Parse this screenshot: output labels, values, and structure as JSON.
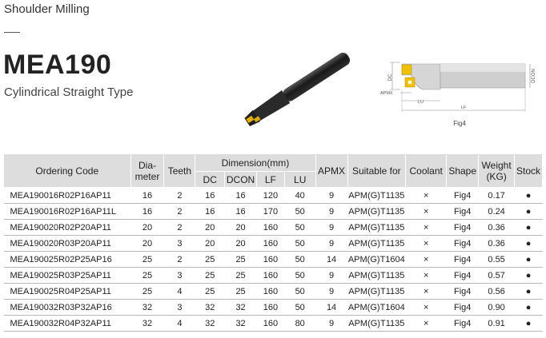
{
  "header": {
    "category": "Shoulder Milling",
    "model": "MEA190",
    "subtitle": "Cylindrical Straight Type"
  },
  "drawing": {
    "labels": {
      "dc": "DC",
      "dcon": "DCON",
      "apmx": "APMX",
      "lu": "LU",
      "lf": "LF"
    },
    "caption": "Fig4"
  },
  "table": {
    "headers": {
      "ordering_code": "Ordering Code",
      "diameter": "Dia-meter",
      "teeth": "Teeth",
      "dimension": "Dimension(mm)",
      "dc": "DC",
      "dcon": "DCON",
      "lf": "LF",
      "lu": "LU",
      "apmx": "APMX",
      "suitable_for": "Suitable for",
      "coolant": "Coolant",
      "shape": "Shape",
      "weight": "Weight (KG)",
      "stock": "Stock"
    },
    "rows": [
      {
        "code": "MEA190016R02P16AP11",
        "dia": "16",
        "teeth": "2",
        "dc": "16",
        "dcon": "16",
        "lf": "120",
        "lu": "40",
        "apmx": "9",
        "insert": "APM(G)T1135",
        "coolant": "×",
        "shape": "Fig4",
        "weight": "0.17",
        "stock": "●"
      },
      {
        "code": "MEA190016R02P16AP11L",
        "dia": "16",
        "teeth": "2",
        "dc": "16",
        "dcon": "16",
        "lf": "170",
        "lu": "50",
        "apmx": "9",
        "insert": "APM(G)T1135",
        "coolant": "×",
        "shape": "Fig4",
        "weight": "0.24",
        "stock": "●"
      },
      {
        "code": "MEA190020R02P20AP11",
        "dia": "20",
        "teeth": "2",
        "dc": "20",
        "dcon": "20",
        "lf": "160",
        "lu": "50",
        "apmx": "9",
        "insert": "APM(G)T1135",
        "coolant": "×",
        "shape": "Fig4",
        "weight": "0.36",
        "stock": "●"
      },
      {
        "code": "MEA190020R03P20AP11",
        "dia": "20",
        "teeth": "3",
        "dc": "20",
        "dcon": "20",
        "lf": "160",
        "lu": "50",
        "apmx": "9",
        "insert": "APM(G)T1135",
        "coolant": "×",
        "shape": "Fig4",
        "weight": "0.36",
        "stock": "●"
      },
      {
        "code": "MEA190025R02P25AP16",
        "dia": "25",
        "teeth": "2",
        "dc": "25",
        "dcon": "25",
        "lf": "160",
        "lu": "50",
        "apmx": "14",
        "insert": "APM(G)T1604",
        "coolant": "×",
        "shape": "Fig4",
        "weight": "0.55",
        "stock": "●"
      },
      {
        "code": "MEA190025R03P25AP11",
        "dia": "25",
        "teeth": "3",
        "dc": "25",
        "dcon": "25",
        "lf": "160",
        "lu": "50",
        "apmx": "9",
        "insert": "APM(G)T1135",
        "coolant": "×",
        "shape": "Fig4",
        "weight": "0.57",
        "stock": "●"
      },
      {
        "code": "MEA190025R04P25AP11",
        "dia": "25",
        "teeth": "4",
        "dc": "25",
        "dcon": "25",
        "lf": "160",
        "lu": "50",
        "apmx": "9",
        "insert": "APM(G)T1135",
        "coolant": "×",
        "shape": "Fig4",
        "weight": "0.56",
        "stock": "●"
      },
      {
        "code": "MEA190032R03P32AP16",
        "dia": "32",
        "teeth": "3",
        "dc": "32",
        "dcon": "32",
        "lf": "160",
        "lu": "50",
        "apmx": "14",
        "insert": "APM(G)T1604",
        "coolant": "×",
        "shape": "Fig4",
        "weight": "0.90",
        "stock": "●"
      },
      {
        "code": "MEA190032R04P32AP11",
        "dia": "32",
        "teeth": "4",
        "dc": "32",
        "dcon": "32",
        "lf": "160",
        "lu": "80",
        "apmx": "9",
        "insert": "APM(G)T1135",
        "coolant": "×",
        "shape": "Fig4",
        "weight": "0.91",
        "stock": "●"
      }
    ]
  }
}
